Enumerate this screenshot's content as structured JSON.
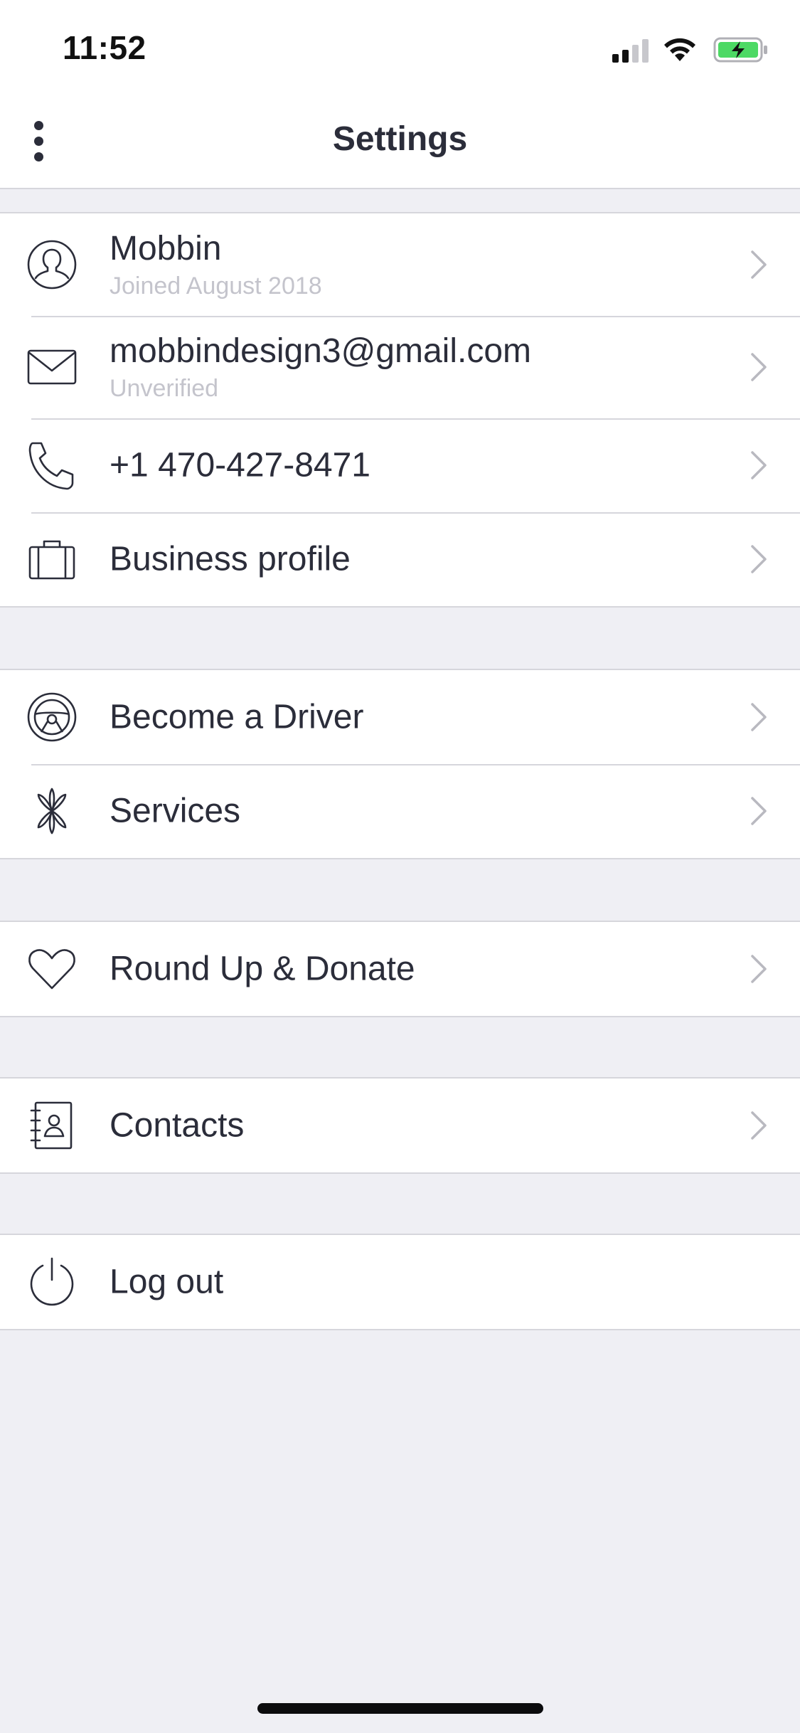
{
  "status_bar": {
    "time": "11:52",
    "icons": [
      "signal-icon",
      "wifi-icon",
      "battery-charging-icon"
    ]
  },
  "nav": {
    "title": "Settings",
    "menu_icon": "more-vertical-icon"
  },
  "groups": [
    {
      "items": [
        {
          "icon": "user-icon",
          "label": "Mobbin",
          "sublabel": "Joined August 2018"
        },
        {
          "icon": "mail-icon",
          "label": "mobbindesign3@gmail.com",
          "sublabel": "Unverified"
        },
        {
          "icon": "phone-icon",
          "label": "+1 470-427-8471"
        },
        {
          "icon": "briefcase-icon",
          "label": "Business profile"
        }
      ]
    },
    {
      "items": [
        {
          "icon": "steering-wheel-icon",
          "label": "Become a Driver"
        },
        {
          "icon": "asterisk-icon",
          "label": "Services"
        }
      ]
    },
    {
      "items": [
        {
          "icon": "heart-icon",
          "label": "Round Up & Donate"
        }
      ]
    },
    {
      "items": [
        {
          "icon": "address-book-icon",
          "label": "Contacts"
        }
      ]
    },
    {
      "items": [
        {
          "icon": "power-icon",
          "label": "Log out"
        }
      ]
    }
  ],
  "colors": {
    "text": "#2b2d3a",
    "subtext": "#c4c4cc",
    "background": "#efeff4",
    "separator": "#d6d6dc",
    "chevron": "#b9b9c0",
    "battery": "#4cd964"
  }
}
